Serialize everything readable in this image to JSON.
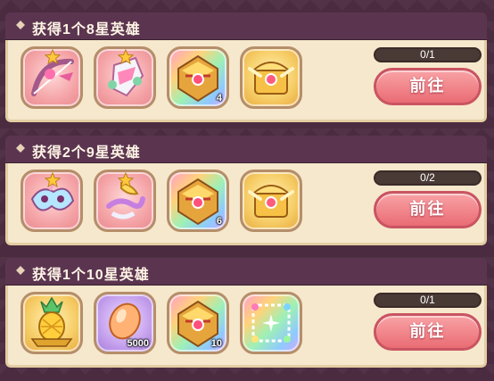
{
  "quests": [
    {
      "title": "获得1个8星英雄",
      "progress_text": "0/1",
      "progress": 0,
      "button_label": "前往",
      "rewards": [
        {
          "icon": "bow-icon",
          "bg": "pink",
          "count": "",
          "star": true
        },
        {
          "icon": "armor-icon",
          "bg": "pink",
          "count": "",
          "star": true
        },
        {
          "icon": "treasure-box-icon",
          "bg": "rainbow",
          "count": "4",
          "star": false
        },
        {
          "icon": "gold-chest-icon",
          "bg": "gold",
          "count": "",
          "star": false
        }
      ]
    },
    {
      "title": "获得2个9星英雄",
      "progress_text": "0/2",
      "progress": 0,
      "button_label": "前往",
      "rewards": [
        {
          "icon": "mask-icon",
          "bg": "pink",
          "count": "",
          "star": true
        },
        {
          "icon": "ornate-mask-icon",
          "bg": "pink",
          "count": "",
          "star": true
        },
        {
          "icon": "treasure-box-icon",
          "bg": "rainbow",
          "count": "6",
          "star": false
        },
        {
          "icon": "gold-chest-icon",
          "bg": "gold",
          "count": "",
          "star": false
        }
      ]
    },
    {
      "title": "获得1个10星英雄",
      "progress_text": "0/1",
      "progress": 0,
      "button_label": "前往",
      "rewards": [
        {
          "icon": "pineapple-icon",
          "bg": "gold",
          "count": "",
          "star": false
        },
        {
          "icon": "gem-stone-icon",
          "bg": "purple",
          "count": "5000",
          "star": false
        },
        {
          "icon": "treasure-box-icon",
          "bg": "rainbow",
          "count": "10",
          "star": false
        },
        {
          "icon": "sparkle-frame-icon",
          "bg": "rainbow",
          "count": "",
          "star": false
        }
      ]
    }
  ]
}
